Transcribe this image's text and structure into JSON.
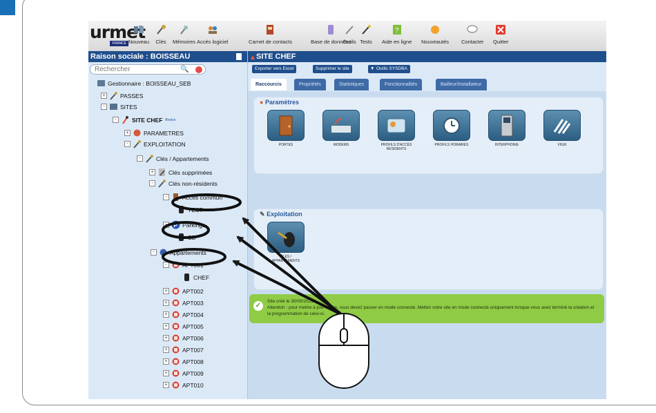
{
  "toolbar": {
    "logo": "urmet",
    "logo_sub": "FRANCE",
    "items": [
      {
        "label": "Nouveau"
      },
      {
        "label": "Clés"
      },
      {
        "label": "Mémoires"
      },
      {
        "label": "Accès logiciel"
      },
      {
        "label": "Carnet de contacts"
      },
      {
        "label": "Base de données"
      },
      {
        "label": "Outils"
      },
      {
        "label": "Tests"
      },
      {
        "label": "Aide en ligne"
      },
      {
        "label": "Nouveautés"
      },
      {
        "label": "Contacter"
      },
      {
        "label": "Quitter"
      }
    ]
  },
  "sidebar": {
    "title": "Raison sociale : BOISSEAU",
    "search_placeholder": "Rechercher",
    "tree": [
      "Gestionnaire : BOISSEAU_SEB",
      "PASSES",
      "SITES",
      "SITE CHEF",
      "PARAMETRES",
      "EXPLOITATION",
      "Clés / Appartements",
      "Clés supprimées",
      "Clés non-résidents",
      "Accès commun",
      "TEST",
      "Parkings",
      "SB",
      "Appartements",
      "APT001",
      "CHEF",
      "APT002",
      "APT003",
      "APT004",
      "APT005",
      "APT006",
      "APT007",
      "APT008",
      "APT009",
      "APT010"
    ],
    "site_badge": "Bvoice"
  },
  "main": {
    "title": "SITE CHEF",
    "actions": [
      "Exporter vers Excel",
      "Supprimer le site",
      "Outils SYSDBA"
    ],
    "tabs": [
      "Raccourcis",
      "Propriétés",
      "Statistiques",
      "Fonctionnalités",
      "Bailleur/Installateur"
    ],
    "params_title": "Paramètres",
    "params_tiles": [
      "Portes",
      "Modems",
      "Profils d'accès Résidents",
      "Profils horaires",
      "Interphonie",
      "VIGIK"
    ],
    "exploit_title": "Exploitation",
    "exploit_tiles": [
      "Clés / Appartements"
    ],
    "notice_line1": "Site créé le 30/09/2022",
    "notice_line2": "Attention : pour mettre à jour le site, vous devez passer en mode connecté. Mettez votre site en mode connecté uniquement lorsque vous avez terminé la création et la programmation de celui-ci."
  },
  "colors": {
    "header_blue": "#1f4e8c",
    "panel_bg": "#dbe9f7",
    "notice_green": "#8fcb45",
    "corner_tab": "#1a6fb5"
  }
}
